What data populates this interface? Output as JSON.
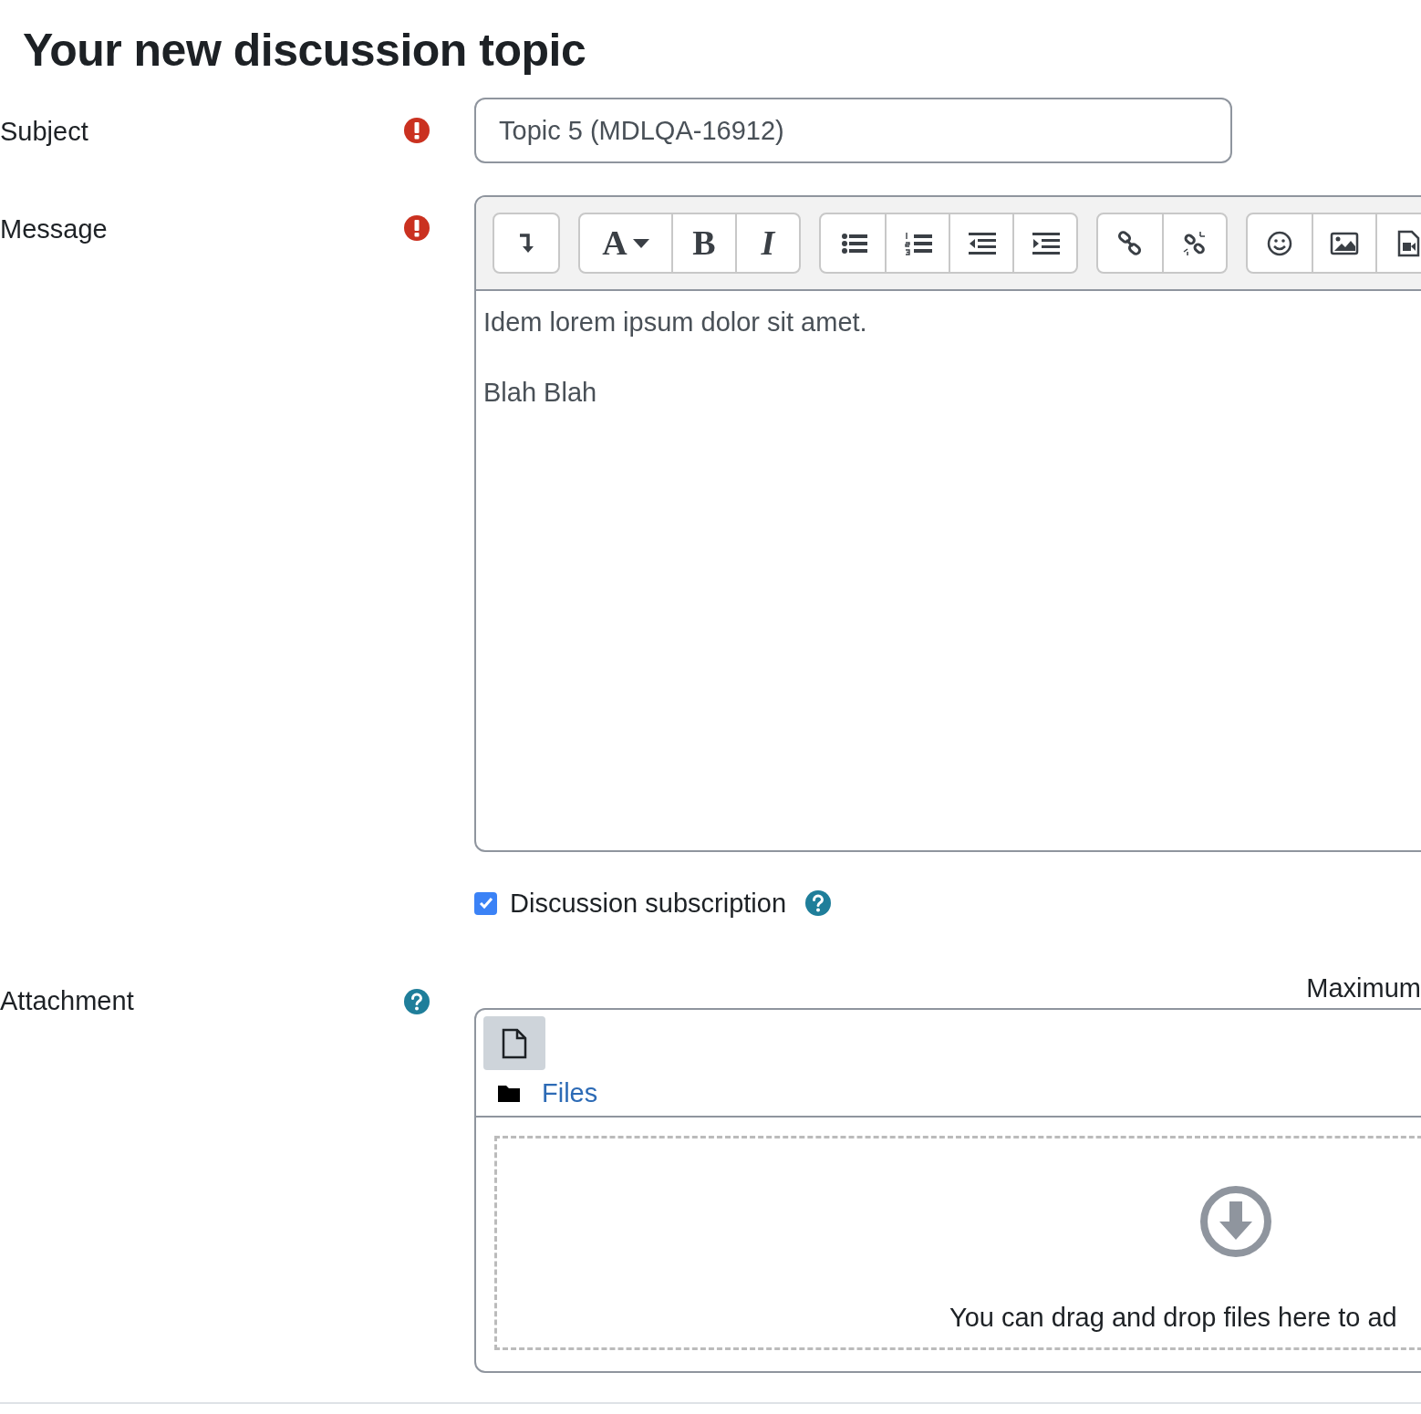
{
  "title": "Your new discussion topic",
  "subject": {
    "label": "Subject",
    "required": true,
    "value": "Topic 5 (MDLQA-16912)"
  },
  "message": {
    "label": "Message",
    "required": true,
    "toolbar": [
      [
        {
          "kind": "collapse"
        }
      ],
      [
        {
          "kind": "font",
          "glyph": "A"
        },
        {
          "kind": "bold",
          "glyph": "B"
        },
        {
          "kind": "italic",
          "glyph": "I"
        }
      ],
      [
        {
          "kind": "bullets"
        },
        {
          "kind": "numbers"
        },
        {
          "kind": "outdent"
        },
        {
          "kind": "indent"
        }
      ],
      [
        {
          "kind": "link"
        },
        {
          "kind": "unlink"
        }
      ],
      [
        {
          "kind": "emoji"
        },
        {
          "kind": "image"
        },
        {
          "kind": "video"
        }
      ]
    ],
    "paragraphs": [
      "Idem lorem ipsum dolor sit amet.",
      "Blah Blah"
    ]
  },
  "subscription": {
    "label": "Discussion subscription",
    "checked": true,
    "help": true
  },
  "attachment": {
    "label": "Attachment",
    "help": true,
    "maximum": "Maximum",
    "files_label": "Files",
    "drop_text": "You can drag and drop files here to ad"
  }
}
